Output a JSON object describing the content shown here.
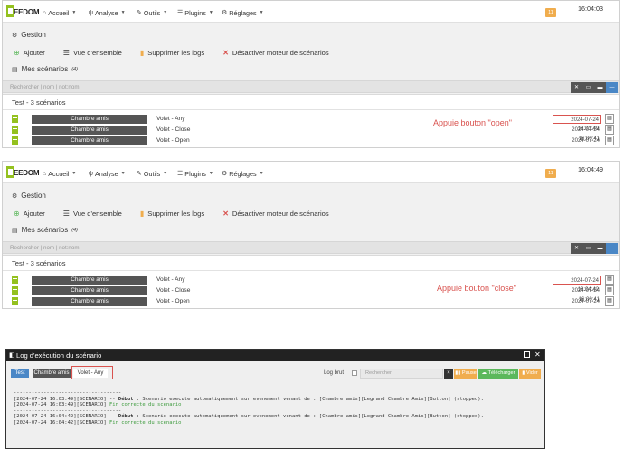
{
  "navbar": {
    "logo": "EEDOM",
    "menu": [
      {
        "label": "Accueil",
        "icon": "home-icon"
      },
      {
        "label": "Analyse",
        "icon": "stethoscope-icon"
      },
      {
        "label": "Outils",
        "icon": "wrench-icon"
      },
      {
        "label": "Plugins",
        "icon": "list-icon"
      },
      {
        "label": "Réglages",
        "icon": "gear-icon"
      }
    ],
    "badge": "11"
  },
  "panels": [
    {
      "time": "16:04:03",
      "section_title": "Gestion",
      "actions": [
        "Ajouter",
        "Vue d'ensemble",
        "Supprimer les logs",
        "Désactiver moteur de scénarios"
      ],
      "my_scenarios": "Mes scénarios",
      "my_scenarios_count": "(4)",
      "search_placeholder": "Rechercher | nom | not:nom",
      "group_title": "Test - 3 scénarios",
      "rows": [
        {
          "object": "Chambre amis",
          "name": "Volet - Any",
          "date": "2024-07-24 16:03:49",
          "highlight": true
        },
        {
          "object": "Chambre amis",
          "name": "Volet - Close",
          "date": "2024-07-24 16:00:41",
          "highlight": false
        },
        {
          "object": "Chambre amis",
          "name": "Volet - Open",
          "date": "2024-07-24 16:01:21",
          "highlight": false
        }
      ],
      "annotation": "Appuie bouton \"open\""
    },
    {
      "time": "16:04:49",
      "section_title": "Gestion",
      "actions": [
        "Ajouter",
        "Vue d'ensemble",
        "Supprimer les logs",
        "Désactiver moteur de scénarios"
      ],
      "my_scenarios": "Mes scénarios",
      "my_scenarios_count": "(4)",
      "search_placeholder": "Rechercher | nom | not:nom",
      "group_title": "Test - 3 scénarios",
      "rows": [
        {
          "object": "Chambre amis",
          "name": "Volet - Any",
          "date": "2024-07-24 16:04:42",
          "highlight": true
        },
        {
          "object": "Chambre amis",
          "name": "Volet - Close",
          "date": "2024-07-24 16:00:41",
          "highlight": false
        },
        {
          "object": "Chambre amis",
          "name": "Volet - Open",
          "date": "2024-07-24 16:01:21",
          "highlight": false
        }
      ],
      "annotation": "Appuie bouton \"close\""
    }
  ],
  "log": {
    "title": "Log d'exécution du scénario",
    "tabs": [
      "Test",
      "Chambre amis",
      "Volet - Any"
    ],
    "log_brut": "Log brut",
    "search_placeholder": "Rechercher",
    "buttons": {
      "clear": "×",
      "pause": "Pause",
      "download": "Télécharger",
      "empty": "Vider"
    },
    "lines": [
      {
        "pre": "------------------------------------",
        "bold": "",
        "post": "",
        "ok": false
      },
      {
        "pre": "[2024-07-24 16:03:49][SCENARIO] -- ",
        "bold": "Début",
        "post": " : Scenario execute automatiquement sur evenement venant de : [Chambre amis][Legrand Chambre Amis][Button] (stopped).",
        "ok": false
      },
      {
        "pre": "[2024-07-24 16:03:49][SCENARIO] ",
        "bold": "",
        "post": "Fin correcte du scénario",
        "ok": true
      },
      {
        "pre": "------------------------------------",
        "bold": "",
        "post": "",
        "ok": false
      },
      {
        "pre": "[2024-07-24 16:04:42][SCENARIO] -- ",
        "bold": "Début",
        "post": " : Scenario execute automatiquement sur evenement venant de : [Chambre amis][Legrand Chambre Amis][Button] (stopped).",
        "ok": false
      },
      {
        "pre": "[2024-07-24 16:04:42][SCENARIO] ",
        "bold": "",
        "post": "Fin correcte du scénario",
        "ok": true
      }
    ]
  },
  "colors": {
    "accent_blue": "#4a87c6",
    "warning": "#f0ad4e",
    "success": "#5cb85c",
    "danger": "#d9534f",
    "dark": "#555555"
  }
}
